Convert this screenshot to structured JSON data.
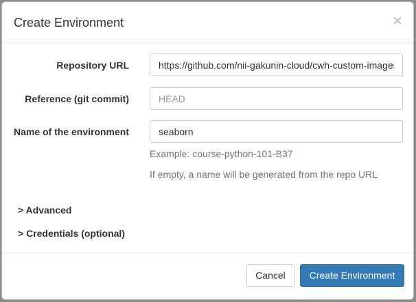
{
  "dialog": {
    "title": "Create Environment",
    "close_label": "×"
  },
  "form": {
    "repository_url": {
      "label": "Repository URL",
      "value": "https://github.com/nii-gakunin-cloud/cwh-custom-images"
    },
    "reference": {
      "label": "Reference (git commit)",
      "placeholder": "HEAD",
      "value": ""
    },
    "environment_name": {
      "label": "Name of the environment",
      "value": "seaborn",
      "help_example": "Example: course-python-101-B37",
      "help_empty": "If empty, a name will be generated from the repo URL"
    }
  },
  "sections": {
    "advanced": "> Advanced",
    "credentials": "> Credentials (optional)"
  },
  "footer": {
    "cancel_label": "Cancel",
    "create_label": "Create Environment"
  },
  "colors": {
    "primary": "#337ab7",
    "backdrop": "#8a8a8a"
  }
}
